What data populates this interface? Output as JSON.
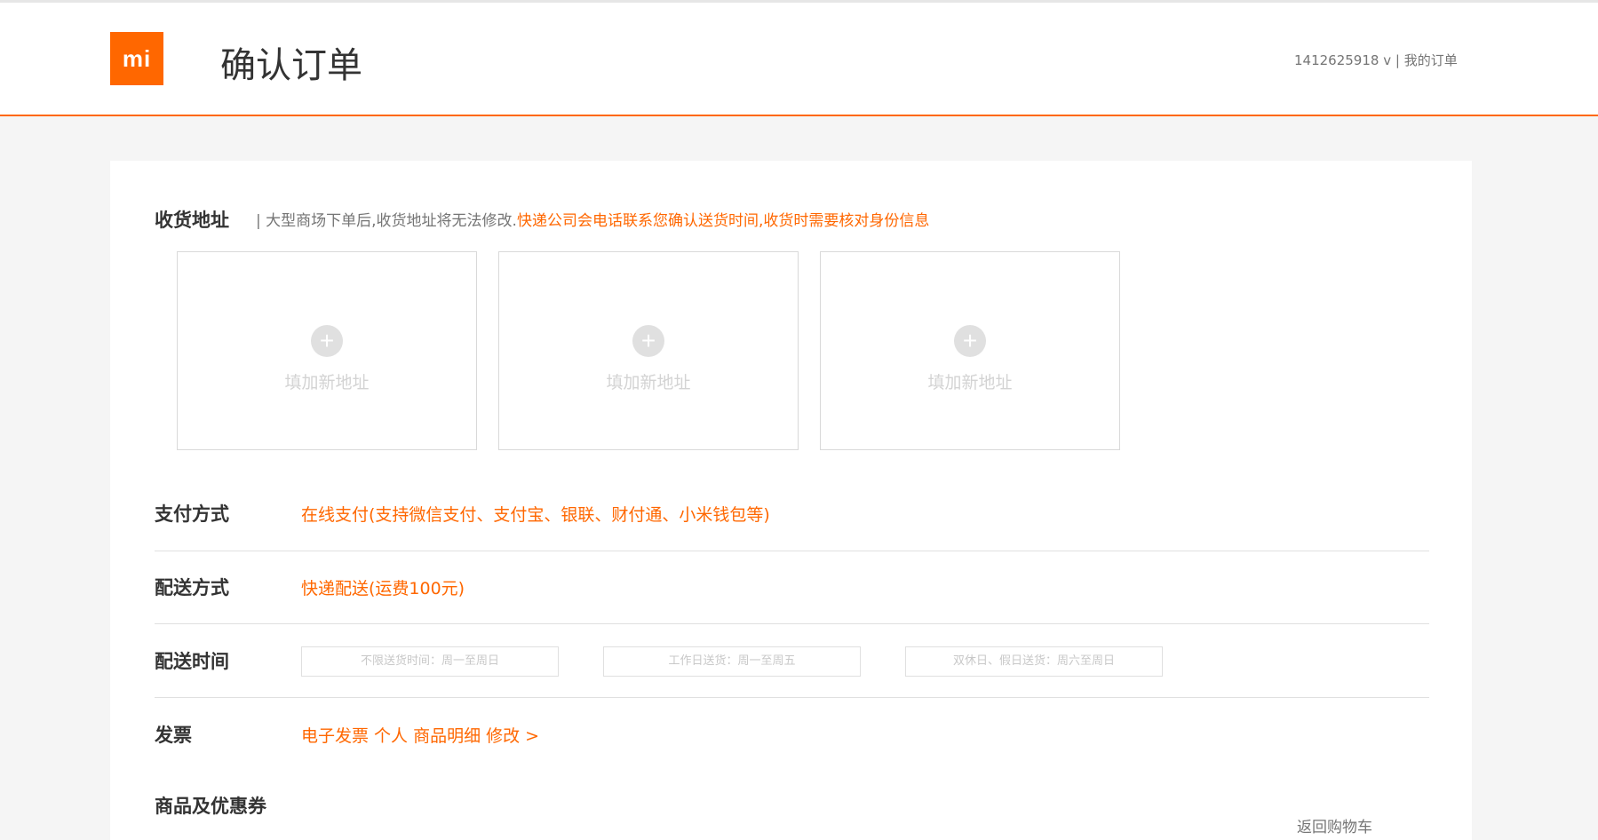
{
  "header": {
    "logo_text": "mi",
    "title": "确认订单",
    "user_id": "1412625918",
    "user_caret": "v",
    "separator": "|",
    "my_orders": "我的订单"
  },
  "address": {
    "label": "收货地址",
    "hint_prefix": "| 大型商场下单后,收货地址将无法修改.",
    "hint_highlight": "快递公司会电话联系您确认送货时间,收货时需要核对身份信息",
    "cards": [
      {
        "plus": "+",
        "label": "填加新地址"
      },
      {
        "plus": "+",
        "label": "填加新地址"
      },
      {
        "plus": "+",
        "label": "填加新地址"
      }
    ]
  },
  "payment": {
    "label": "支付方式",
    "value": "在线支付(支持微信支付、支付宝、银联、财付通、小米钱包等)"
  },
  "shipping": {
    "label": "配送方式",
    "value": "快递配送(运费100元)"
  },
  "delivery_time": {
    "label": "配送时间",
    "options": [
      "不限送货时间：周一至周日",
      "工作日送货：周一至周五",
      "双休日、假日送货：周六至周日"
    ]
  },
  "invoice": {
    "label": "发票",
    "value": "电子发票 个人 商品明细 修改 >"
  },
  "goods": {
    "label": "商品及优惠券",
    "back_link": "返回购物车"
  },
  "colors": {
    "accent": "#ff6700",
    "text": "#333333",
    "muted": "#757575"
  }
}
